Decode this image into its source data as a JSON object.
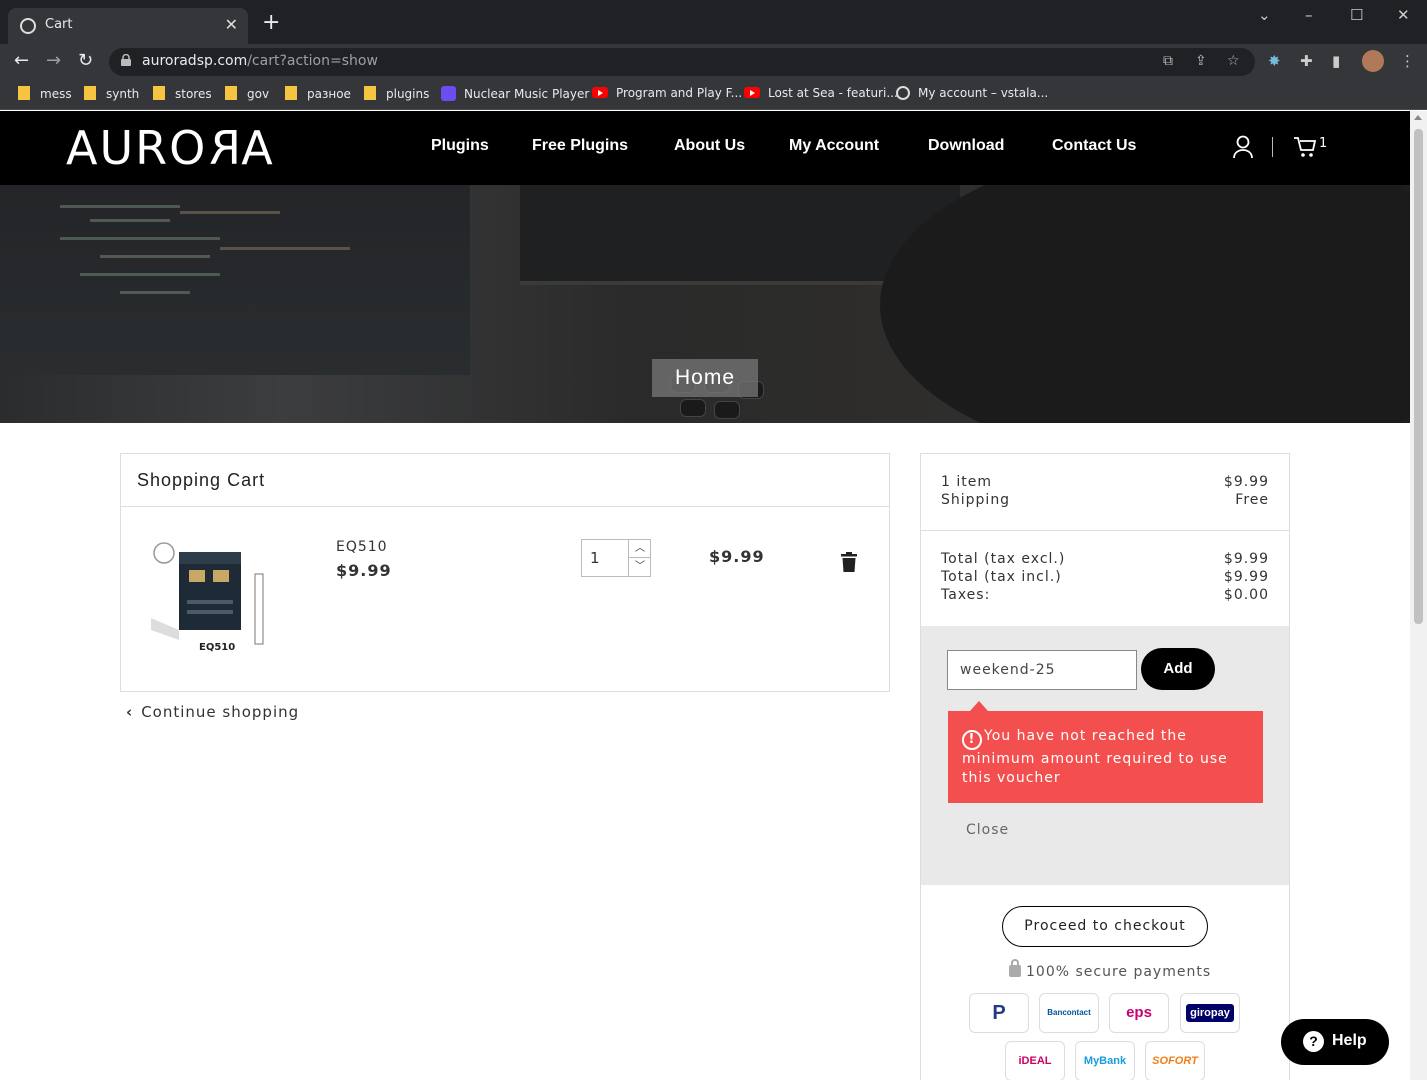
{
  "browser": {
    "tab_title": "Cart",
    "new_tab": "+",
    "url_host": "auroradsp.com",
    "url_path": "/cart?action=show",
    "window_controls": [
      "⌄",
      "–",
      "☐",
      "✕"
    ]
  },
  "bookmarks": [
    {
      "label": "mess",
      "icon": "folder-icon"
    },
    {
      "label": "synth",
      "icon": "folder-icon"
    },
    {
      "label": "stores",
      "icon": "folder-icon"
    },
    {
      "label": "gov",
      "icon": "folder-icon"
    },
    {
      "label": "разное",
      "icon": "folder-icon"
    },
    {
      "label": "plugins",
      "icon": "folder-icon"
    },
    {
      "label": "Nuclear Music Player",
      "icon": "nuclear-icon"
    },
    {
      "label": "Program and Play F...",
      "icon": "youtube-icon"
    },
    {
      "label": "Lost at Sea - featuri...",
      "icon": "youtube-icon"
    },
    {
      "label": "My account – vstala...",
      "icon": "globe-icon"
    }
  ],
  "site": {
    "logo_a": "AURO",
    "logo_r": "R",
    "logo_b": "A",
    "nav": [
      "Plugins",
      "Free Plugins",
      "About Us",
      "My Account",
      "Download",
      "Contact Us"
    ],
    "cart_count": "1",
    "hero_title": "Home"
  },
  "cart": {
    "title": "Shopping Cart",
    "item": {
      "name": "EQ510",
      "price": "$9.99",
      "qty": "1",
      "line_total": "$9.99",
      "image_label": "EQ510"
    },
    "continue_label": "Continue shopping"
  },
  "summary": {
    "items_label": "1 item",
    "items_value": "$9.99",
    "shipping_label": "Shipping",
    "shipping_value": "Free",
    "total_excl_label": "Total (tax excl.)",
    "total_excl_value": "$9.99",
    "total_incl_label": "Total (tax incl.)",
    "total_incl_value": "$9.99",
    "taxes_label": "Taxes:",
    "taxes_value": "$0.00",
    "voucher_value": "weekend-25",
    "voucher_add": "Add",
    "voucher_error": "You have not reached the minimum amount required to use this voucher",
    "voucher_close": "Close",
    "checkout_label": "Proceed to checkout",
    "secure_label": "100% secure payments",
    "payments": [
      "PayPal",
      "Bancontact",
      "eps",
      "giropay",
      "iDEAL",
      "MyBank",
      "SOFORT"
    ]
  },
  "help_label": "Help",
  "colors": {
    "error_bg": "#f44f4f",
    "header_bg": "#000000",
    "voucher_bg": "#e9e9e9"
  }
}
